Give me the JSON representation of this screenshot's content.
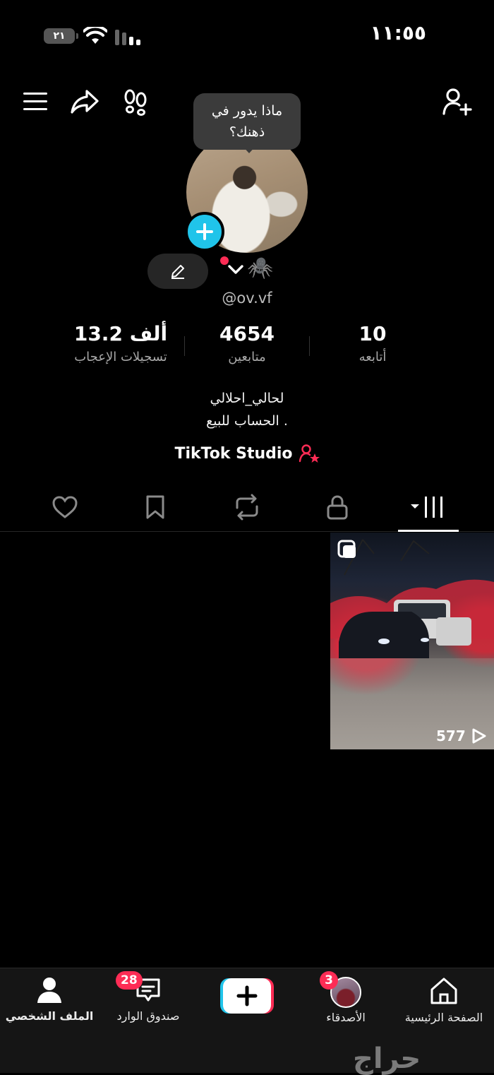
{
  "status_bar": {
    "time": "١١:٥٥",
    "battery": "٢١"
  },
  "prompt_bubble": {
    "line1": "ماذا يدور في",
    "line2": "ذهنك؟"
  },
  "profile": {
    "username_emoji": "🕷️",
    "handle": "@ov.vf",
    "stats": [
      {
        "value": "10",
        "label": "أتابعه"
      },
      {
        "value": "4654",
        "label": "متابعين"
      },
      {
        "value": "13.2 ألف",
        "label": "تسجيلات الإعجاب"
      }
    ],
    "bio_line1": "لحالي_احلالي",
    "bio_line2": "الحساب للبيع .",
    "studio_label": "TikTok Studio"
  },
  "tabs": [
    "videos",
    "private",
    "reposts",
    "favorites",
    "liked"
  ],
  "video": {
    "views": "577"
  },
  "bottom_nav": {
    "home": "الصفحة الرئيسية",
    "friends": "الأصدقاء",
    "friends_badge": "3",
    "inbox": "صندوق الوارد",
    "inbox_badge": "28",
    "profile": "الملف الشخصي"
  },
  "watermark": "حراج",
  "colors": {
    "accent": "#fe2c55",
    "cyan": "#20c4ea",
    "background": "#000000"
  }
}
